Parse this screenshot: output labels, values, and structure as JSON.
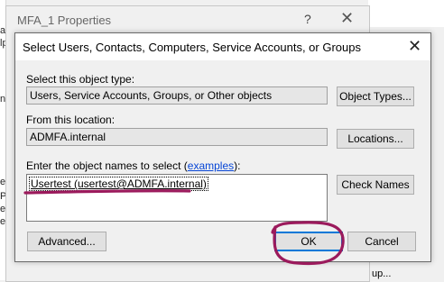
{
  "background": {
    "left_fragments": [
      "an",
      "lp",
      "n",
      "er",
      "Pri",
      "e",
      "e A"
    ],
    "right_fragment": "up..."
  },
  "properties_window": {
    "title": "MFA_1 Properties",
    "help_glyph": "?",
    "close_glyph": "✕"
  },
  "dialog": {
    "title": "Select Users, Contacts, Computers, Service Accounts, or Groups",
    "close_glyph": "✕",
    "object_type": {
      "label": "Select this object type:",
      "value": "Users, Service Accounts, Groups, or Other objects",
      "button": "Object Types..."
    },
    "location": {
      "label": "From this location:",
      "value": "ADMFA.internal",
      "button": "Locations..."
    },
    "names": {
      "label_prefix": "Enter the object names to select (",
      "label_link": "examples",
      "label_suffix": "):",
      "value": "Usertest (usertest@ADMFA.internal)",
      "check_button": "Check Names"
    },
    "advanced_button": "Advanced...",
    "ok_button": "OK",
    "cancel_button": "Cancel"
  },
  "annotation": {
    "ink_color": "#9b1a5c"
  }
}
